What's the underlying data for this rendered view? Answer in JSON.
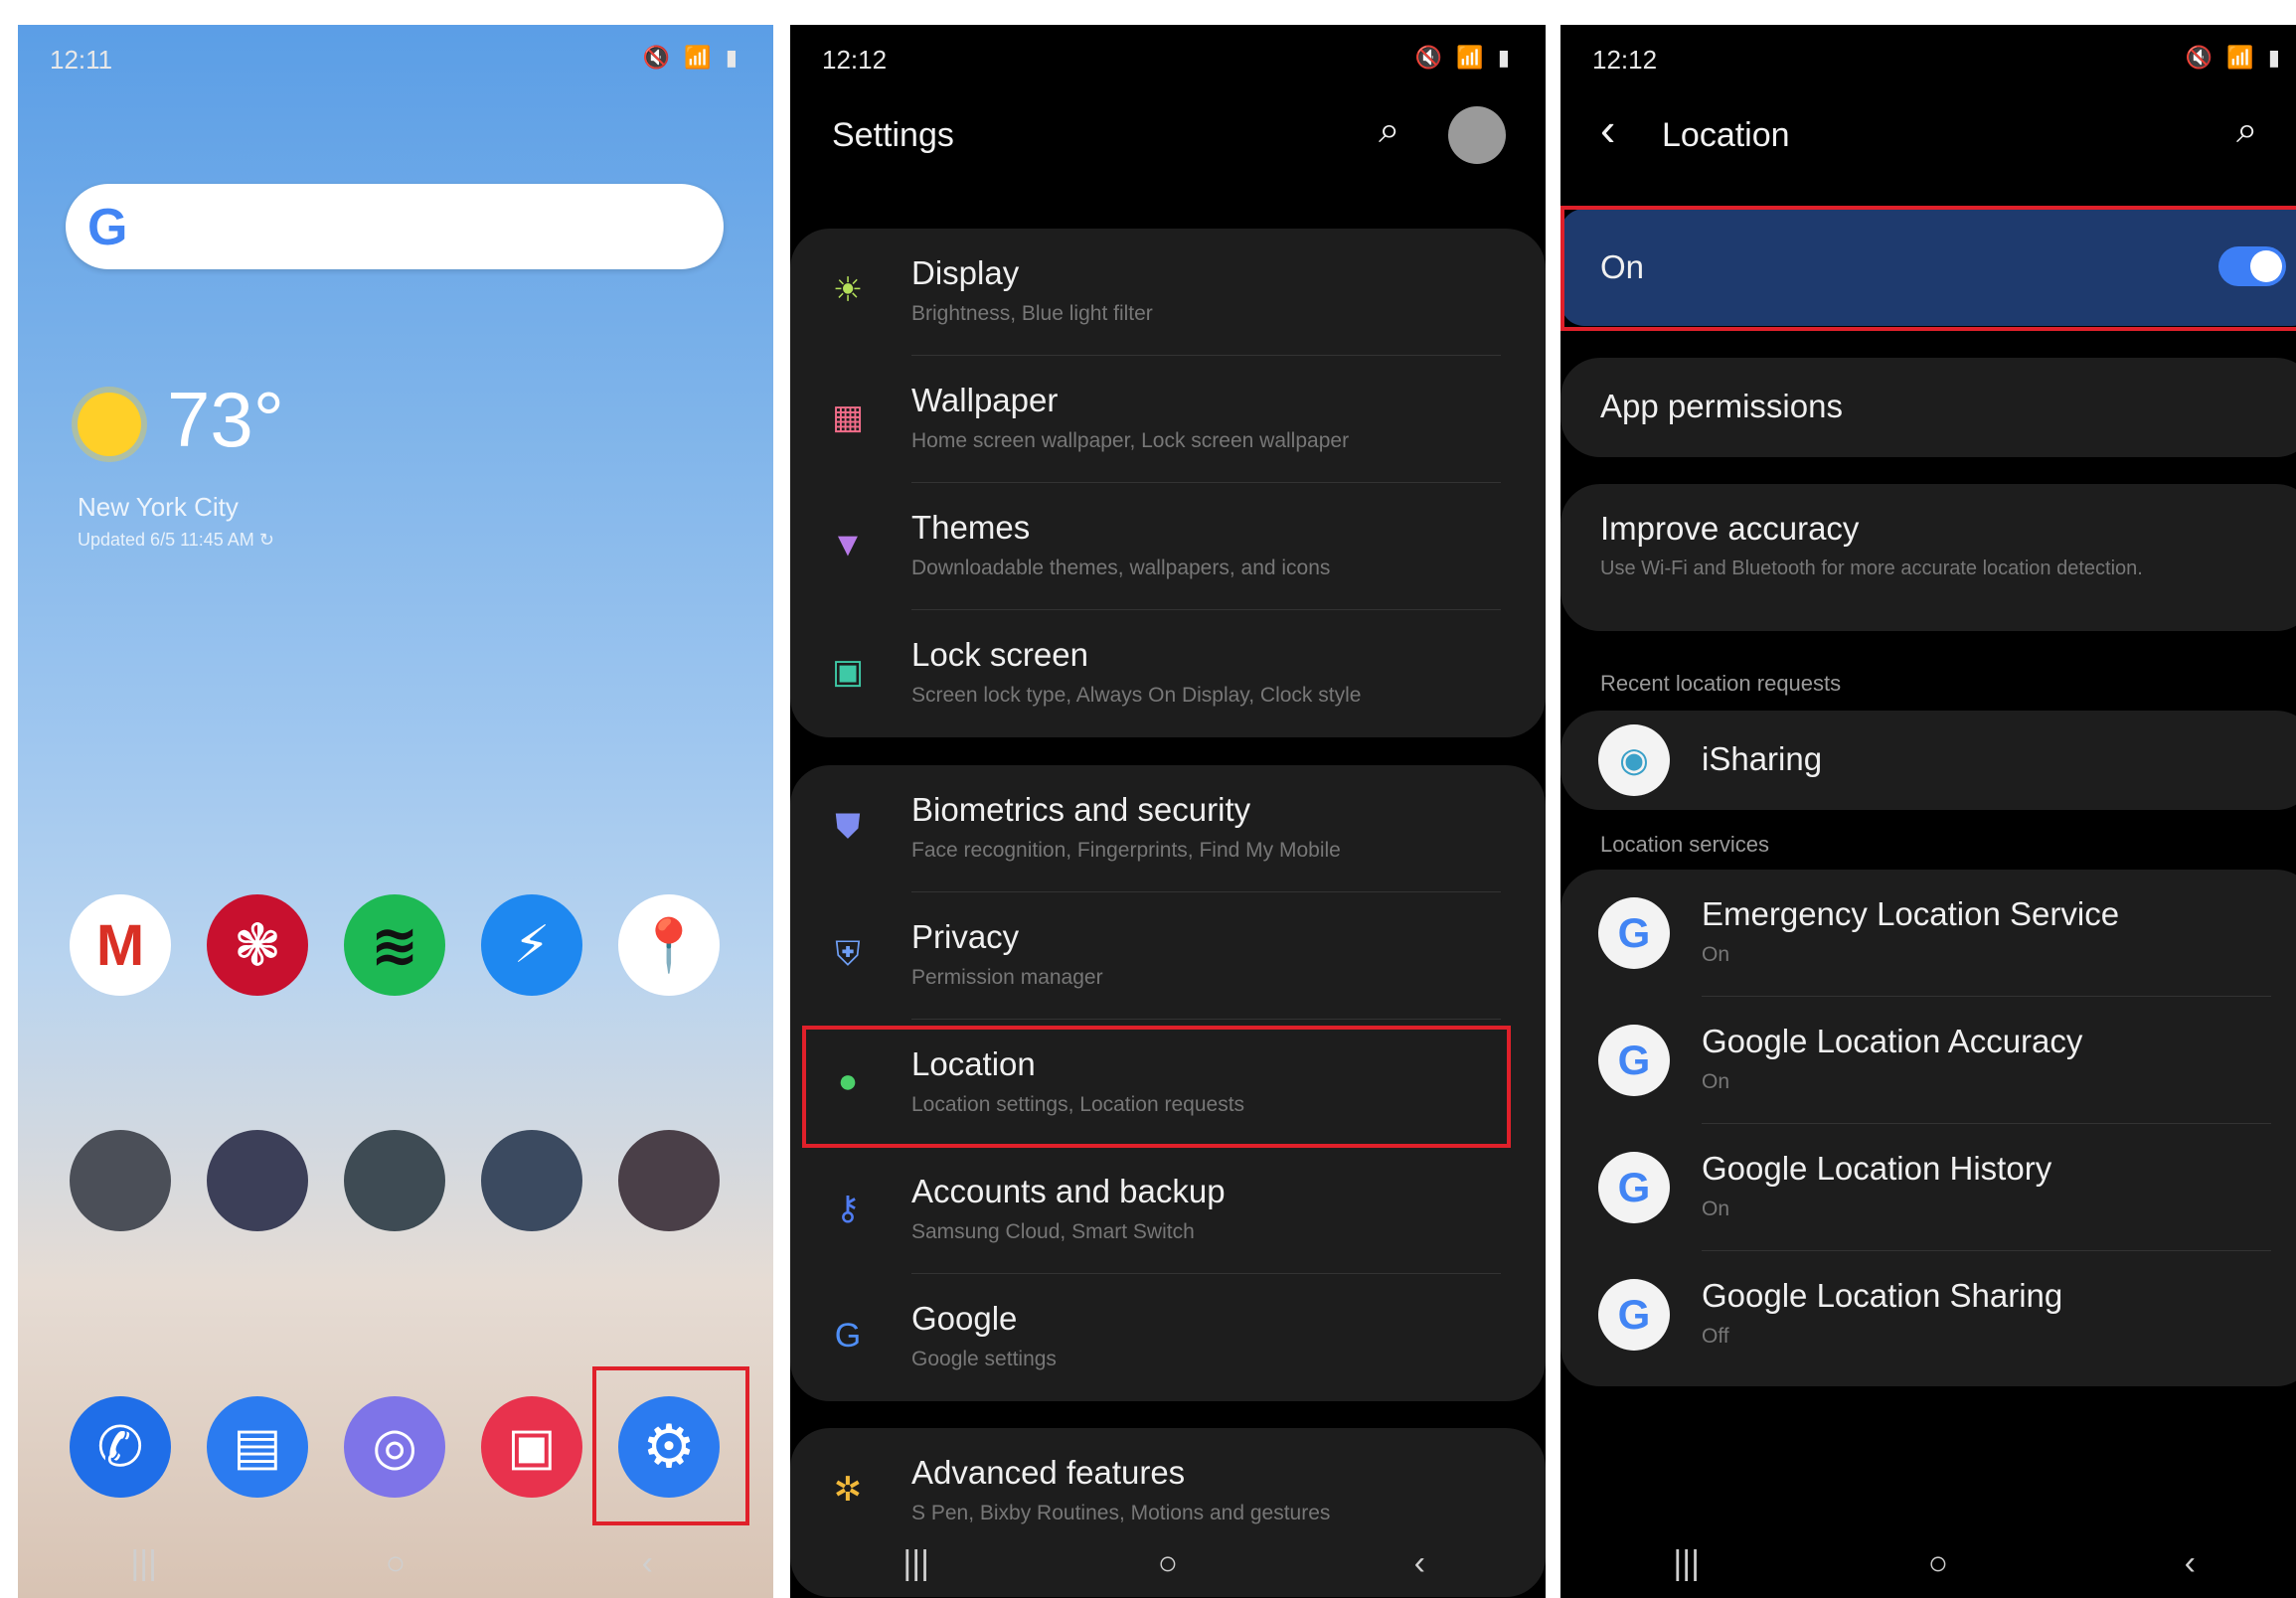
{
  "home": {
    "time": "12:11",
    "status_icons": "🔇 📶 ▮",
    "weather": {
      "temp": "73°",
      "city": "New York City",
      "updated": "Updated 6/5 11:45 AM ↻"
    },
    "search_logo": "G",
    "apps_row1": [
      "M",
      "❃",
      "≋",
      "⚡",
      "📍"
    ],
    "dock": [
      "✆",
      "▤",
      "◎",
      "▣",
      "⚙"
    ]
  },
  "settings": {
    "time": "12:12",
    "status_icons": "🔇 📶 ▮",
    "title": "Settings",
    "groups": [
      [
        {
          "icon": "☀",
          "color": "#b4e05a",
          "title": "Display",
          "sub": "Brightness, Blue light filter"
        },
        {
          "icon": "▦",
          "color": "#f26d8a",
          "title": "Wallpaper",
          "sub": "Home screen wallpaper, Lock screen wallpaper"
        },
        {
          "icon": "▼",
          "color": "#b87ae8",
          "title": "Themes",
          "sub": "Downloadable themes, wallpapers, and icons"
        },
        {
          "icon": "▣",
          "color": "#3ec9a6",
          "title": "Lock screen",
          "sub": "Screen lock type, Always On Display, Clock style"
        }
      ],
      [
        {
          "icon": "⛊",
          "color": "#7e8cf0",
          "title": "Biometrics and security",
          "sub": "Face recognition, Fingerprints, Find My Mobile"
        },
        {
          "icon": "⛨",
          "color": "#6f9ff5",
          "title": "Privacy",
          "sub": "Permission manager"
        },
        {
          "icon": "●",
          "color": "#4cd06a",
          "title": "Location",
          "sub": "Location settings, Location requests"
        },
        {
          "icon": "⚷",
          "color": "#4f7cf2",
          "title": "Accounts and backup",
          "sub": "Samsung Cloud, Smart Switch"
        },
        {
          "icon": "G",
          "color": "#4f8ef5",
          "title": "Google",
          "sub": "Google settings"
        }
      ],
      [
        {
          "icon": "✲",
          "color": "#f2b93a",
          "title": "Advanced features",
          "sub": "S Pen, Bixby Routines, Motions and gestures"
        }
      ]
    ]
  },
  "location": {
    "time": "12:12",
    "status_icons": "🔇 📶 ▮",
    "title": "Location",
    "back": "‹",
    "on_label": "On",
    "app_permissions": "App permissions",
    "improve": {
      "title": "Improve accuracy",
      "sub": "Use Wi-Fi and Bluetooth for more accurate location detection."
    },
    "recent_header": "Recent location requests",
    "recent_app": "iSharing",
    "services_header": "Location services",
    "services": [
      {
        "title": "Emergency Location Service",
        "sub": "On"
      },
      {
        "title": "Google Location Accuracy",
        "sub": "On"
      },
      {
        "title": "Google Location History",
        "sub": "On"
      },
      {
        "title": "Google Location Sharing",
        "sub": "Off"
      }
    ]
  },
  "nav": {
    "recents": "|||",
    "home": "○",
    "back": "‹"
  },
  "colors": {
    "highlight": "#e0202a",
    "accent": "#3d7ef5"
  }
}
